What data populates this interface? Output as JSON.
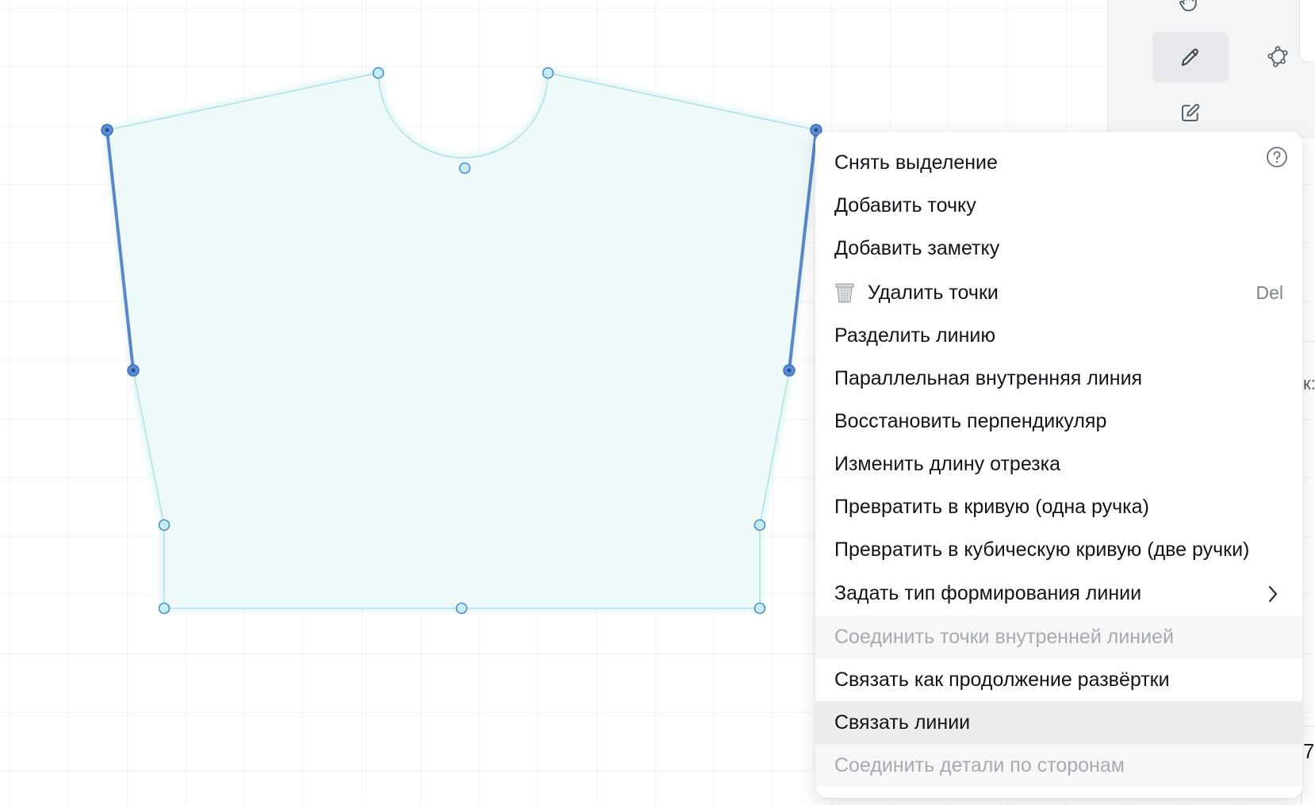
{
  "menu": {
    "help_icon": "question-circle-icon",
    "items": [
      {
        "label": "Снять выделение"
      },
      {
        "label": "Добавить точку"
      },
      {
        "label": "Добавить заметку"
      },
      {
        "label": "Удалить точки",
        "icon": "trash-icon",
        "shortcut": "Del"
      },
      {
        "label": "Разделить линию"
      },
      {
        "label": "Параллельная внутренняя линия"
      },
      {
        "label": "Восстановить перпендикуляр"
      },
      {
        "label": "Изменить длину отрезка"
      },
      {
        "label": "Превратить в кривую (одна ручка)"
      },
      {
        "label": "Превратить в кубическую кривую (две ручки)"
      },
      {
        "label": "Задать тип формирования линии",
        "submenu_icon": "chevron-right-icon"
      },
      {
        "label": "Соединить точки внутренней линией",
        "disabled": true
      },
      {
        "label": "Связать как продолжение развёртки"
      },
      {
        "label": "Связать линии",
        "hovered": true
      },
      {
        "label": "Соединить детали по сторонам",
        "disabled": true
      }
    ]
  },
  "toolbar": {
    "tools": [
      {
        "name": "hand-tool",
        "icon": "hand-icon"
      },
      {
        "name": "pencil-tool",
        "icon": "pencil-icon",
        "active": true
      },
      {
        "name": "polygon-tool",
        "icon": "polygon-nodes-icon"
      },
      {
        "name": "edit-tool",
        "icon": "edit-square-icon"
      }
    ]
  },
  "side_fragments": {
    "partial_label": "к:",
    "partial_value": "7"
  },
  "colors": {
    "shape_fill": "#eefafa",
    "shape_stroke": "#b4e2e4",
    "selected_edge": "#5b86c9",
    "point_fill": "#c7ecf1",
    "point_stroke": "#4a8fc8",
    "selected_point_fill": "#5a8ed6"
  }
}
